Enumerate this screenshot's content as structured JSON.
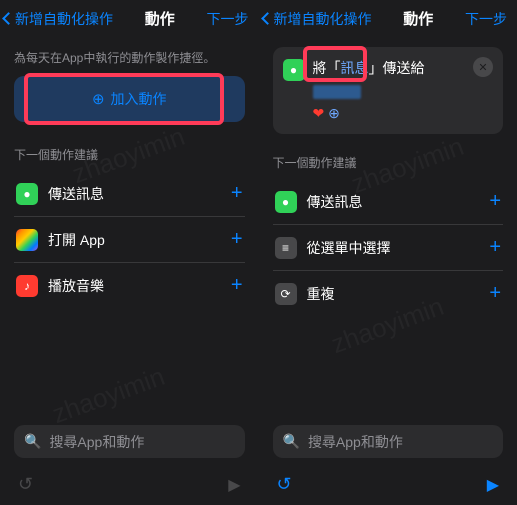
{
  "left": {
    "header": {
      "back": "新增自動化操作",
      "title": "動作",
      "next": "下一步"
    },
    "hint": "為每天在App中執行的動作製作捷徑。",
    "add_action": "加入動作",
    "section_label": "下一個動作建議",
    "suggestions": [
      {
        "icon": "green",
        "glyph": "●",
        "label": "傳送訊息"
      },
      {
        "icon": "grid",
        "glyph": "",
        "label": "打開 App"
      },
      {
        "icon": "red",
        "glyph": "♪",
        "label": "播放音樂"
      }
    ],
    "search_placeholder": "搜尋App和動作"
  },
  "right": {
    "header": {
      "back": "新增自動化操作",
      "title": "動作",
      "next": "下一步"
    },
    "composed": {
      "prefix": "將「",
      "token": "訊息",
      "mid": "」傳送給",
      "heart": "❤"
    },
    "section_label": "下一個動作建議",
    "suggestions": [
      {
        "icon": "green",
        "glyph": "●",
        "label": "傳送訊息"
      },
      {
        "icon": "gray",
        "glyph": "≡",
        "label": "從選單中選擇"
      },
      {
        "icon": "gray",
        "glyph": "⟳",
        "label": "重複"
      }
    ],
    "search_placeholder": "搜尋App和動作"
  },
  "watermark": "zhaoyimin"
}
